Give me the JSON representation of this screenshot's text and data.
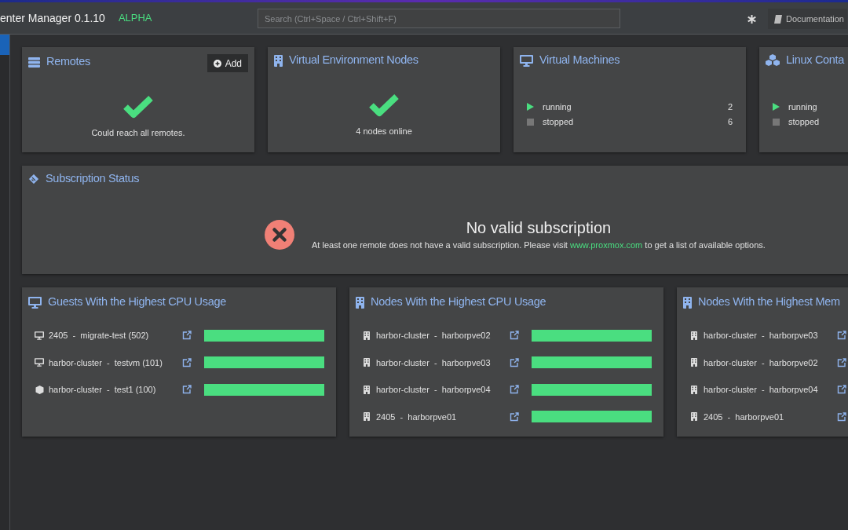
{
  "header": {
    "title": "enter Manager 0.1.10",
    "badge": "ALPHA",
    "search": {
      "placeholder": "Search (Ctrl+Space / Ctrl+Shift+F)"
    },
    "documentation": "Documentation"
  },
  "sidebar": {
    "items": [
      {
        "selected": true
      }
    ]
  },
  "summary_cards": [
    {
      "kind": "status",
      "title": "Remotes",
      "button": "Add",
      "message": "Could reach all remotes."
    },
    {
      "kind": "status",
      "title": "Virtual Environment Nodes",
      "message": "4 nodes online"
    },
    {
      "kind": "counts",
      "title": "Virtual Machines",
      "rows": [
        {
          "state": "running",
          "count": "2"
        },
        {
          "state": "stopped",
          "count": "6"
        }
      ]
    },
    {
      "kind": "counts",
      "title": "Linux Conta",
      "rows": [
        {
          "state": "running"
        },
        {
          "state": "stopped"
        }
      ]
    }
  ],
  "subscription": {
    "title": "Subscription Status",
    "heading": "No valid subscription",
    "text_before": "At least one remote does not have a valid subscription. Please visit",
    "link": "www.proxmox.com",
    "text_after": "to get a list of available options."
  },
  "usage_panels": [
    {
      "title": "Guests With the Highest CPU Usage",
      "rows": [
        {
          "kind": "vm",
          "label": "2405  -  migrate-test (502)",
          "level": 1
        },
        {
          "kind": "vm",
          "label": "harbor-cluster  -  testvm (101)",
          "level": 1
        },
        {
          "kind": "container",
          "label": "harbor-cluster  -  test1 (100)",
          "level": 1
        }
      ]
    },
    {
      "title": "Nodes With the Highest CPU Usage",
      "rows": [
        {
          "kind": "node",
          "label": "harbor-cluster  -  harborpve02",
          "level": 1
        },
        {
          "kind": "node",
          "label": "harbor-cluster  -  harborpve03",
          "level": 1
        },
        {
          "kind": "node",
          "label": "harbor-cluster  -  harborpve04",
          "level": 1
        },
        {
          "kind": "node",
          "label": "2405  -  harborpve01",
          "level": 1
        }
      ]
    },
    {
      "title": "Nodes With the Highest Mem",
      "rows": [
        {
          "kind": "node",
          "label": "harbor-cluster  -  harborpve03"
        },
        {
          "kind": "node",
          "label": "harbor-cluster  -  harborpve02"
        },
        {
          "kind": "node",
          "label": "harbor-cluster  -  harborpve04"
        },
        {
          "kind": "node",
          "label": "2405  -  harborpve01"
        }
      ]
    }
  ]
}
